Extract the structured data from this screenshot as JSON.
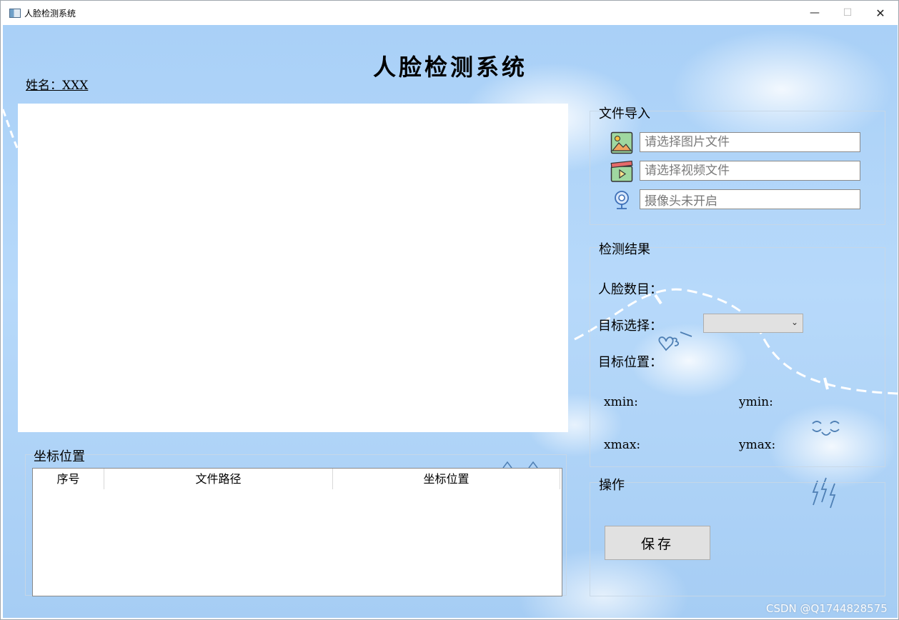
{
  "window": {
    "title": "人脸检测系统"
  },
  "header": {
    "app_title": "人脸检测系统",
    "name_label": "姓名：XXX"
  },
  "coord_panel": {
    "title": "坐标位置",
    "columns": [
      "序号",
      "文件路径",
      "坐标位置"
    ]
  },
  "file_import": {
    "title": "文件导入",
    "image_placeholder": "请选择图片文件",
    "video_placeholder": "请选择视频文件",
    "camera_value": "摄像头未开启"
  },
  "detection": {
    "title": "检测结果",
    "face_count_label": "人脸数目：",
    "target_select_label": "目标选择：",
    "target_position_label": "目标位置：",
    "xmin_label": "xmin:",
    "ymin_label": "ymin:",
    "xmax_label": "xmax:",
    "ymax_label": "ymax:"
  },
  "operation": {
    "title": "操作",
    "save_label": "保存"
  },
  "watermark": "CSDN @Q1744828575",
  "colors": {
    "background": "#a9d0f7",
    "panel": "#ffffff",
    "button": "#e1e1e1"
  }
}
